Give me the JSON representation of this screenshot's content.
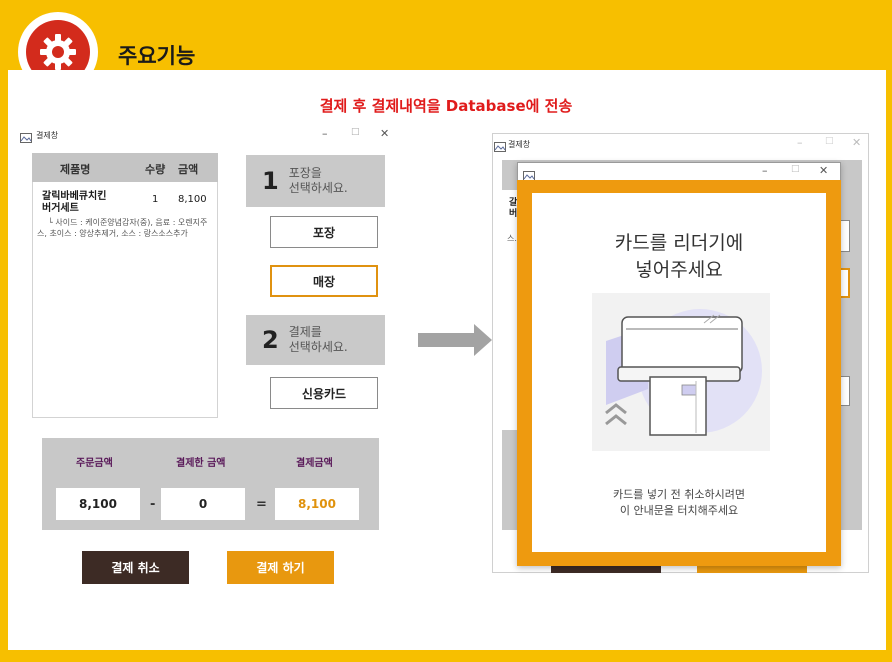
{
  "header": {
    "title": "주요기능"
  },
  "subtitle": "결제 후 결제내역을 Database에 전송",
  "left_window": {
    "title": "결제창",
    "controls": {
      "minimize": "–",
      "maximize": "□",
      "close": "✕"
    },
    "table": {
      "headers": [
        "제품명",
        "수량",
        "금액"
      ],
      "rows": [
        {
          "name_line1": "갈릭바베큐치킨",
          "name_line2": "버거세트",
          "qty": "1",
          "price": "8,100",
          "detail_line1": "└ 사이드 : 케이준양념감자(중), 음료 : 오렌지주",
          "detail_line2": "스, 초이스 : 양상추제거, 소스 : 랑스소스추가"
        }
      ]
    },
    "step1": {
      "num": "1",
      "text_line1": "포장을",
      "text_line2": "선택하세요."
    },
    "btn_takeout": "포장",
    "btn_dinein": "매장",
    "step2": {
      "num": "2",
      "text_line1": "결제를",
      "text_line2": "선택하세요."
    },
    "btn_card": "신용카드",
    "summary": {
      "labels": [
        "주문금액",
        "결제한 금액",
        "결제금액"
      ],
      "values": [
        "8,100",
        "0",
        "8,100"
      ],
      "op_minus": "-",
      "op_equals": "="
    },
    "btn_cancel": "결제 취소",
    "btn_pay": "결제 하기"
  },
  "right_window": {
    "title": "결제창",
    "controls": {
      "minimize": "–",
      "maximize": "□",
      "close": "✕"
    },
    "partial_texts": {
      "row_a": "갈",
      "row_b": "버",
      "row_c": "스."
    }
  },
  "popup": {
    "controls": {
      "minimize": "–",
      "maximize": "□",
      "close": "✕"
    },
    "title_line1": "카드를 리더기에",
    "title_line2": "넣어주세요",
    "sub_line1": "카드를 넣기 전 취소하시려면",
    "sub_line2": "이 안내문을 터치해주세요"
  },
  "colors": {
    "background": "#f7bf00",
    "accent_orange": "#e8980f",
    "logo_red": "#d32b1c",
    "subtitle_red": "#e01b1b",
    "cancel_brown": "#3d2b25"
  },
  "icons": [
    "gear-icon",
    "window-app-icon",
    "arrow-right-icon",
    "card-reader-illustration"
  ]
}
